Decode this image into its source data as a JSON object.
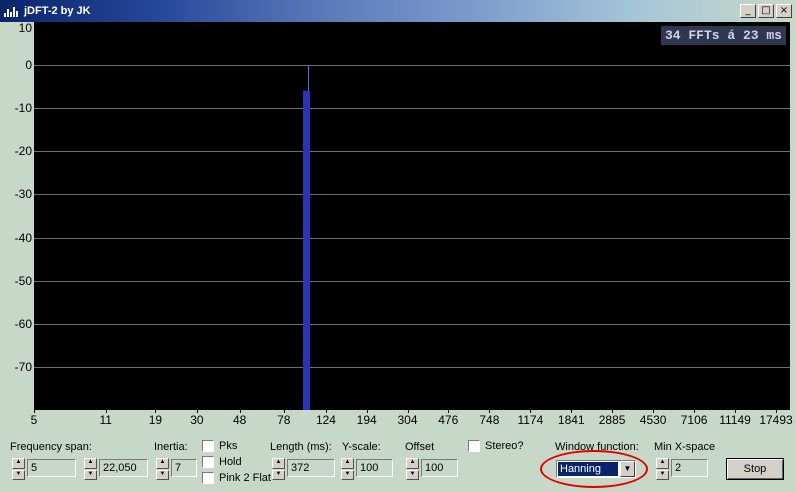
{
  "window": {
    "title": "jDFT-2 by JK",
    "minimize_glyph": "_",
    "maximize_glyph": "□",
    "close_glyph": "×"
  },
  "plot": {
    "fft_status": "34 FFTs á 23 ms",
    "y_tick_labels": [
      "10",
      "0",
      "-10",
      "-20",
      "-30",
      "-40",
      "-50",
      "-60",
      "-70"
    ],
    "x_tick_labels": [
      "5",
      "11",
      "19",
      "30",
      "48",
      "78",
      "124",
      "194",
      "304",
      "476",
      "748",
      "1174",
      "1841",
      "2885",
      "4530",
      "7106",
      "11149",
      "17493"
    ],
    "colors": {
      "background": "#000000",
      "grid": "#6e6e6e",
      "spectrum": "#2c34b4"
    }
  },
  "chart_data": {
    "type": "bar",
    "title": "",
    "xlabel": "",
    "ylabel": "",
    "ylim": [
      -80,
      10
    ],
    "x_scale": "log",
    "y_ticks": [
      10,
      0,
      -10,
      -20,
      -30,
      -40,
      -50,
      -60,
      -70
    ],
    "x_ticks": [
      5,
      11,
      19,
      30,
      48,
      78,
      124,
      194,
      304,
      476,
      748,
      1174,
      1841,
      2885,
      4530,
      7106,
      11149,
      17493
    ],
    "grid": true,
    "series": [
      {
        "values": [
          {
            "x": 100,
            "y": -6
          },
          {
            "x": 102,
            "y": 0
          }
        ]
      }
    ]
  },
  "controls": {
    "frequency_span": {
      "label": "Frequency span:",
      "from": "5",
      "to": "22,050"
    },
    "inertia": {
      "label": "Inertia:",
      "value": "7"
    },
    "checkboxes": {
      "pks": "Pks",
      "hold": "Hold",
      "pink": "Pink 2 Flat"
    },
    "length": {
      "label": "Length (ms):",
      "value": "372"
    },
    "y_scale": {
      "label": "Y-scale:",
      "value": "100"
    },
    "offset": {
      "label": "Offset",
      "value": "100"
    },
    "stereo": {
      "label": "Stereo?"
    },
    "window_function": {
      "label": "Window function:",
      "selected": "Hanning"
    },
    "min_x_space": {
      "label": "Min X-space",
      "value": "2"
    },
    "stop_label": "Stop",
    "spin_up_glyph": "▲",
    "spin_down_glyph": "▼",
    "dropdown_glyph": "▼"
  }
}
